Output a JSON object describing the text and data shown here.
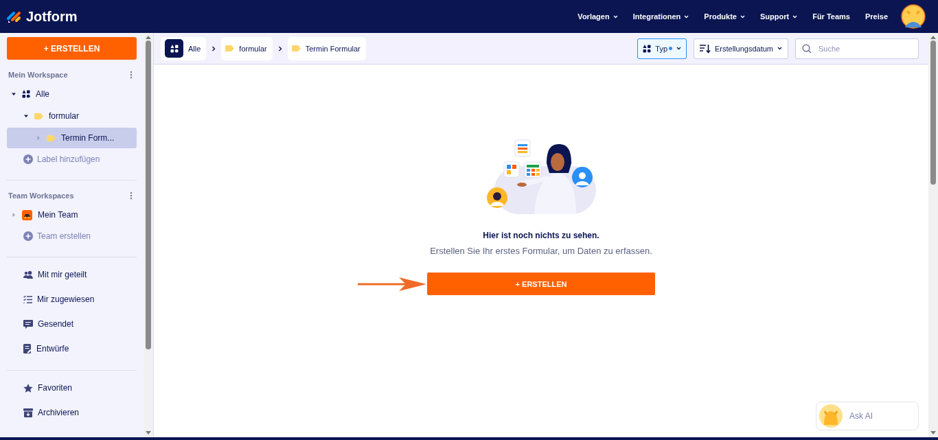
{
  "header": {
    "logo_text": "Jotform",
    "nav": [
      {
        "label": "Vorlagen",
        "dropdown": true
      },
      {
        "label": "Integrationen",
        "dropdown": true
      },
      {
        "label": "Produkte",
        "dropdown": true
      },
      {
        "label": "Support",
        "dropdown": true
      },
      {
        "label": "Für Teams",
        "dropdown": false
      },
      {
        "label": "Preise",
        "dropdown": false
      }
    ]
  },
  "sidebar": {
    "create_button": "+ ERSTELLEN",
    "my_workspace": {
      "title": "Mein Workspace",
      "tree": [
        {
          "label": "Alle",
          "kind": "all",
          "expanded": true,
          "selected": false,
          "children": [
            {
              "label": "formular",
              "kind": "label",
              "expanded": true,
              "selected": false,
              "children": [
                {
                  "label": "Termin Form...",
                  "kind": "label",
                  "expanded": false,
                  "selected": true
                }
              ]
            }
          ]
        }
      ],
      "add_label": "Label hinzufügen"
    },
    "team_workspaces": {
      "title": "Team Workspaces",
      "items": [
        {
          "label": "Mein Team",
          "expanded": false
        }
      ],
      "add_label": "Team erstellen"
    },
    "nav_groups": [
      [
        {
          "label": "Mit mir geteilt",
          "kind": "shared"
        },
        {
          "label": "Mir zugewiesen",
          "kind": "assigned"
        },
        {
          "label": "Gesendet",
          "kind": "sent"
        },
        {
          "label": "Entwürfe",
          "kind": "drafts"
        }
      ],
      [
        {
          "label": "Favoriten",
          "kind": "favorites"
        },
        {
          "label": "Archivieren",
          "kind": "archive"
        }
      ]
    ]
  },
  "toolbar": {
    "breadcrumbs": [
      {
        "label": "Alle",
        "kind": "all"
      },
      {
        "label": "formular",
        "kind": "label"
      },
      {
        "label": "Termin Formular",
        "kind": "label"
      }
    ],
    "type_filter": {
      "label": "Typ",
      "active": true
    },
    "sort": {
      "label": "Erstellungsdatum"
    },
    "search": {
      "placeholder": "Suche"
    }
  },
  "empty_state": {
    "title": "Hier ist noch nichts zu sehen.",
    "text": "Erstellen Sie Ihr erstes Formular, um Daten zu erfassen.",
    "button": "+ ERSTELLEN"
  },
  "ask_ai": {
    "label": "Ask AI"
  }
}
